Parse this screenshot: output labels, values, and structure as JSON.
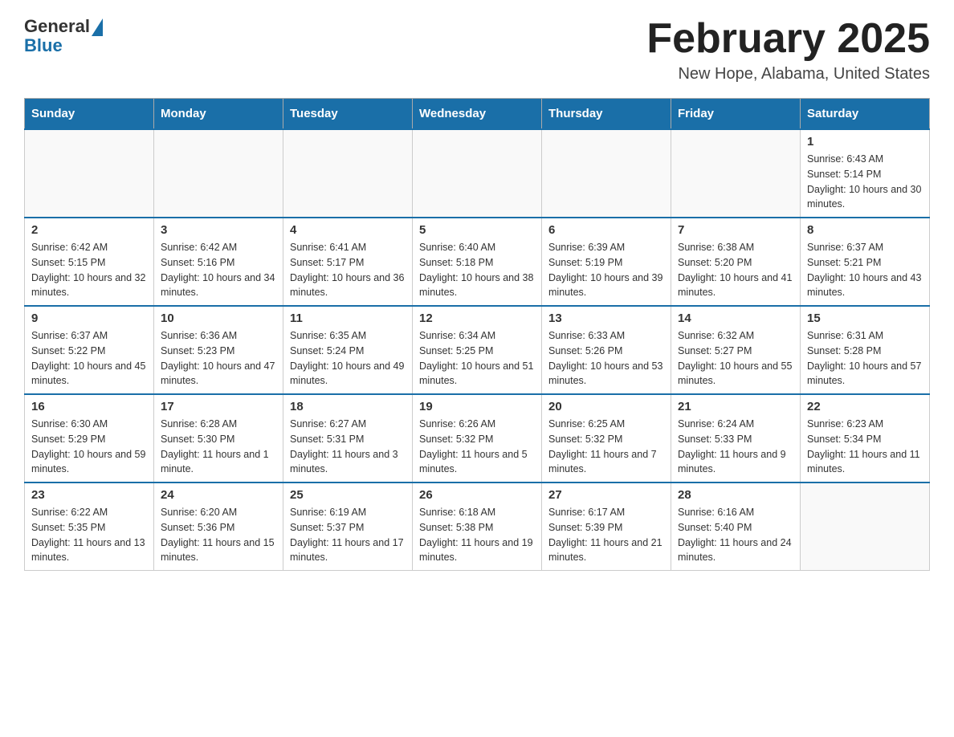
{
  "logo": {
    "general": "General",
    "blue": "Blue"
  },
  "title": "February 2025",
  "location": "New Hope, Alabama, United States",
  "days_of_week": [
    "Sunday",
    "Monday",
    "Tuesday",
    "Wednesday",
    "Thursday",
    "Friday",
    "Saturday"
  ],
  "weeks": [
    [
      {
        "day": "",
        "info": ""
      },
      {
        "day": "",
        "info": ""
      },
      {
        "day": "",
        "info": ""
      },
      {
        "day": "",
        "info": ""
      },
      {
        "day": "",
        "info": ""
      },
      {
        "day": "",
        "info": ""
      },
      {
        "day": "1",
        "info": "Sunrise: 6:43 AM\nSunset: 5:14 PM\nDaylight: 10 hours and 30 minutes."
      }
    ],
    [
      {
        "day": "2",
        "info": "Sunrise: 6:42 AM\nSunset: 5:15 PM\nDaylight: 10 hours and 32 minutes."
      },
      {
        "day": "3",
        "info": "Sunrise: 6:42 AM\nSunset: 5:16 PM\nDaylight: 10 hours and 34 minutes."
      },
      {
        "day": "4",
        "info": "Sunrise: 6:41 AM\nSunset: 5:17 PM\nDaylight: 10 hours and 36 minutes."
      },
      {
        "day": "5",
        "info": "Sunrise: 6:40 AM\nSunset: 5:18 PM\nDaylight: 10 hours and 38 minutes."
      },
      {
        "day": "6",
        "info": "Sunrise: 6:39 AM\nSunset: 5:19 PM\nDaylight: 10 hours and 39 minutes."
      },
      {
        "day": "7",
        "info": "Sunrise: 6:38 AM\nSunset: 5:20 PM\nDaylight: 10 hours and 41 minutes."
      },
      {
        "day": "8",
        "info": "Sunrise: 6:37 AM\nSunset: 5:21 PM\nDaylight: 10 hours and 43 minutes."
      }
    ],
    [
      {
        "day": "9",
        "info": "Sunrise: 6:37 AM\nSunset: 5:22 PM\nDaylight: 10 hours and 45 minutes."
      },
      {
        "day": "10",
        "info": "Sunrise: 6:36 AM\nSunset: 5:23 PM\nDaylight: 10 hours and 47 minutes."
      },
      {
        "day": "11",
        "info": "Sunrise: 6:35 AM\nSunset: 5:24 PM\nDaylight: 10 hours and 49 minutes."
      },
      {
        "day": "12",
        "info": "Sunrise: 6:34 AM\nSunset: 5:25 PM\nDaylight: 10 hours and 51 minutes."
      },
      {
        "day": "13",
        "info": "Sunrise: 6:33 AM\nSunset: 5:26 PM\nDaylight: 10 hours and 53 minutes."
      },
      {
        "day": "14",
        "info": "Sunrise: 6:32 AM\nSunset: 5:27 PM\nDaylight: 10 hours and 55 minutes."
      },
      {
        "day": "15",
        "info": "Sunrise: 6:31 AM\nSunset: 5:28 PM\nDaylight: 10 hours and 57 minutes."
      }
    ],
    [
      {
        "day": "16",
        "info": "Sunrise: 6:30 AM\nSunset: 5:29 PM\nDaylight: 10 hours and 59 minutes."
      },
      {
        "day": "17",
        "info": "Sunrise: 6:28 AM\nSunset: 5:30 PM\nDaylight: 11 hours and 1 minute."
      },
      {
        "day": "18",
        "info": "Sunrise: 6:27 AM\nSunset: 5:31 PM\nDaylight: 11 hours and 3 minutes."
      },
      {
        "day": "19",
        "info": "Sunrise: 6:26 AM\nSunset: 5:32 PM\nDaylight: 11 hours and 5 minutes."
      },
      {
        "day": "20",
        "info": "Sunrise: 6:25 AM\nSunset: 5:32 PM\nDaylight: 11 hours and 7 minutes."
      },
      {
        "day": "21",
        "info": "Sunrise: 6:24 AM\nSunset: 5:33 PM\nDaylight: 11 hours and 9 minutes."
      },
      {
        "day": "22",
        "info": "Sunrise: 6:23 AM\nSunset: 5:34 PM\nDaylight: 11 hours and 11 minutes."
      }
    ],
    [
      {
        "day": "23",
        "info": "Sunrise: 6:22 AM\nSunset: 5:35 PM\nDaylight: 11 hours and 13 minutes."
      },
      {
        "day": "24",
        "info": "Sunrise: 6:20 AM\nSunset: 5:36 PM\nDaylight: 11 hours and 15 minutes."
      },
      {
        "day": "25",
        "info": "Sunrise: 6:19 AM\nSunset: 5:37 PM\nDaylight: 11 hours and 17 minutes."
      },
      {
        "day": "26",
        "info": "Sunrise: 6:18 AM\nSunset: 5:38 PM\nDaylight: 11 hours and 19 minutes."
      },
      {
        "day": "27",
        "info": "Sunrise: 6:17 AM\nSunset: 5:39 PM\nDaylight: 11 hours and 21 minutes."
      },
      {
        "day": "28",
        "info": "Sunrise: 6:16 AM\nSunset: 5:40 PM\nDaylight: 11 hours and 24 minutes."
      },
      {
        "day": "",
        "info": ""
      }
    ]
  ]
}
